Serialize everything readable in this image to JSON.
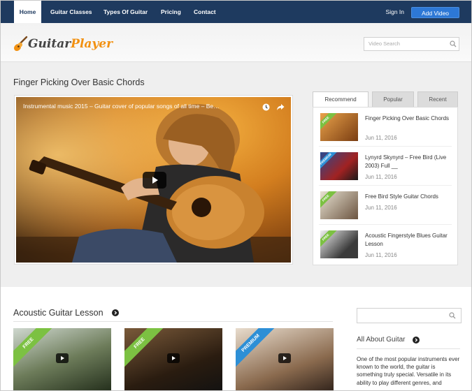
{
  "nav": {
    "items": [
      {
        "label": "Home",
        "active": true
      },
      {
        "label": "Guitar Classes"
      },
      {
        "label": "Types Of Guitar"
      },
      {
        "label": "Pricing"
      },
      {
        "label": "Contact"
      }
    ],
    "signin_label": "Sign In",
    "add_video_label": "Add Video"
  },
  "brand": {
    "logo_part1": "Guitar",
    "logo_part2": "Player",
    "accent": "#f29111"
  },
  "header_search": {
    "placeholder": "Video Search"
  },
  "main": {
    "title": "Finger Picking Over Basic Chords",
    "video": {
      "title": "Instrumental music 2015 – Guitar cover of popular songs of all time – Be…"
    },
    "tabs": [
      "Recommend",
      "Popular",
      "Recent"
    ],
    "list": [
      {
        "title": "Finger Picking Over Basic Chords",
        "date": "Jun 11, 2016",
        "badge": "FREE",
        "badge_color": "#7cc142"
      },
      {
        "title": "Lynyrd Skynyrd – Free Bird (Live 2003) Full __",
        "date": "Jun 11, 2016",
        "badge": "PREMIUM",
        "badge_color": "#2d8fd6"
      },
      {
        "title": "Free Bird Style Guitar Chords",
        "date": "Jun 11, 2016",
        "badge": "FREE",
        "badge_color": "#7cc142"
      },
      {
        "title": "Acoustic Fingerstyle Blues Guitar Lesson",
        "date": "Jun 11, 2016",
        "badge": "FREE",
        "badge_color": "#7cc142"
      }
    ]
  },
  "lower": {
    "title": "Acoustic Guitar Lesson",
    "cards": [
      {
        "badge": "FREE",
        "badge_color": "#7cc142"
      },
      {
        "badge": "FREE",
        "badge_color": "#7cc142"
      },
      {
        "badge": "PREMIUM",
        "badge_color": "#2d8fd6"
      }
    ]
  },
  "sidebar": {
    "about_title": "All About Guitar",
    "about_text": "One of the most popular instruments ever known to the world, the guitar is something truly special. Versatile in its ability to play different genres, and"
  },
  "colors": {
    "nav_bg": "#1e3a5f",
    "button_blue": "#2d78d6"
  }
}
